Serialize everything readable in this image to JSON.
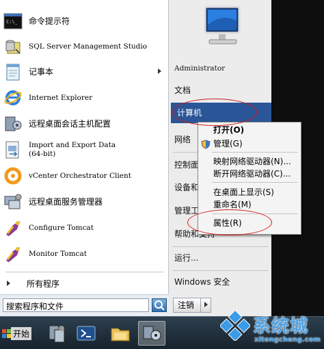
{
  "pinned_programs": [
    {
      "label": "命令提示符",
      "icon": "command-prompt-icon",
      "cjk": true
    },
    {
      "label": "SQL Server Management Studio",
      "icon": "sql-server-icon",
      "cjk": false
    },
    {
      "label": "记事本",
      "icon": "notepad-icon",
      "cjk": true,
      "has_submenu": true
    },
    {
      "label": "Internet Explorer",
      "icon": "internet-explorer-icon",
      "cjk": false
    },
    {
      "label": "远程桌面会话主机配置",
      "icon": "rdsh-config-icon",
      "cjk": true
    },
    {
      "label": "Import and Export Data\n(64-bit)",
      "icon": "import-export-icon",
      "cjk": false
    },
    {
      "label": "vCenter Orchestrator Client",
      "icon": "vcenter-orchestrator-icon",
      "cjk": false
    },
    {
      "label": "远程桌面服务管理器",
      "icon": "rds-manager-icon",
      "cjk": true
    },
    {
      "label": "Configure Tomcat",
      "icon": "configure-tomcat-icon",
      "cjk": false
    },
    {
      "label": "Monitor Tomcat",
      "icon": "monitor-tomcat-icon",
      "cjk": false
    }
  ],
  "all_programs": "所有程序",
  "search": {
    "placeholder": "搜索程序和文件",
    "value": "搜索程序和文件"
  },
  "right_pane": {
    "administrator": "Administrator",
    "documents": "文档",
    "computer": "计算机",
    "network": "网络",
    "control_panel": "控制面板",
    "devices": "设备和打印机",
    "admin_tools": "管理工具",
    "help": "帮助和支持",
    "run": "运行...",
    "windows_security": "Windows 安全",
    "logoff": "注销"
  },
  "context_menu": {
    "open": "打开(O)",
    "manage": "管理(G)",
    "map_drive": "映射网络驱动器(N)...",
    "disconnect_drive": "断开网络驱动器(C)...",
    "show_desktop": "在桌面上显示(S)",
    "rename": "重命名(M)",
    "properties": "属性(R)"
  },
  "taskbar": {
    "start_label": "开始",
    "icons": [
      "server-manager-icon",
      "powershell-icon",
      "explorer-folder-icon",
      "active-tomcat-icon"
    ]
  },
  "watermark": {
    "title": "系统城",
    "url": "xitongcheng.com"
  },
  "colors": {
    "highlight": "#2a5597",
    "annotation": "#d21a1a",
    "watermark": "#4fa3e6"
  }
}
